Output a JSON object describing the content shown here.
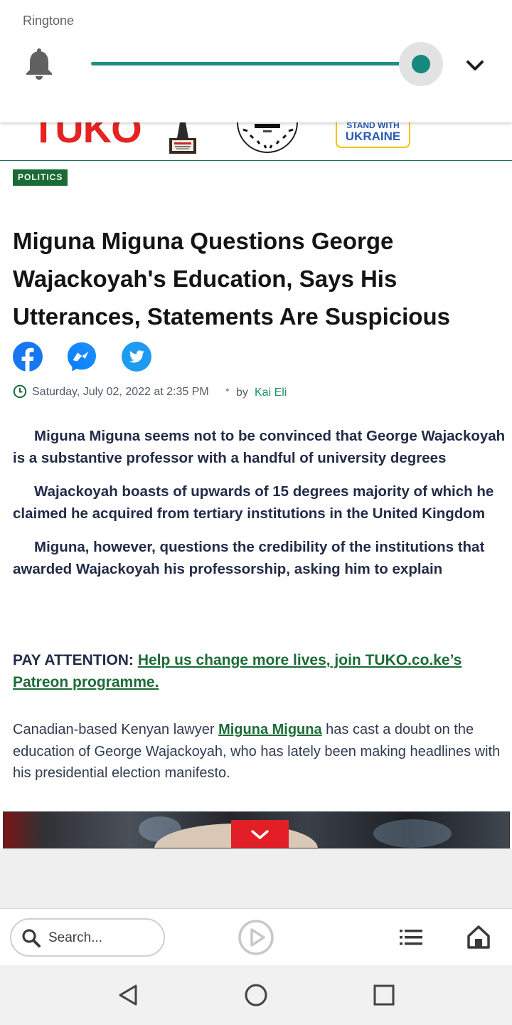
{
  "volume_panel": {
    "label": "Ringtone",
    "level_fraction": 1.0,
    "accent_color": "#15897d"
  },
  "site_header": {
    "logo_text": "TUKO",
    "logo_color": "#e32421",
    "badges": [
      "trophy-award-icon",
      "digital-tech-awards-badge"
    ],
    "ukraine_line1": "STAND WITH",
    "ukraine_line2": "UKRAINE"
  },
  "article": {
    "category": "POLITICS",
    "headline": "Miguna Miguna Questions George Wajackoyah's Education, Says His Utterances, Statements Are Suspicious",
    "share_icons": [
      "facebook-icon",
      "messenger-icon",
      "twitter-icon"
    ],
    "date": "Saturday, July 02, 2022 at 2:35 PM",
    "separator": "•",
    "by_label": "by",
    "author": "Kai Eli",
    "bullets": [
      "Miguna Miguna seems not to be convinced that George Wajackoyah is a substantive professor with a handful of university degrees",
      "Wajackoyah boasts of upwards of 15 degrees majority of which he claimed he acquired from tertiary institutions in the United Kingdom",
      "Miguna, however, questions the credibility of the institutions that awarded Wajackoyah his professorship, asking him to explain"
    ],
    "pay_attention_label": "PAY ATTENTION:",
    "pay_attention_link": "Help us change more lives, join TUKO.co.ke’s Patreon programme.",
    "body_before": "Canadian-based Kenyan lawyer ",
    "body_link": "Miguna Miguna",
    "body_after": " has cast a doubt on the education of George Wajackoyah, who has lately been making headlines with his presidential election manifesto."
  },
  "ad": {
    "close_icon": "chevron-down-icon"
  },
  "bottom_bar": {
    "search_placeholder": "Search...",
    "icons": [
      "search-icon",
      "play-icon",
      "list-icon",
      "home-icon"
    ]
  },
  "system_nav": {
    "icons": [
      "back-icon",
      "home-circle-icon",
      "recents-icon"
    ]
  },
  "colors": {
    "brand_green": "#1b6b36",
    "author_green": "#1b8f6a",
    "text_dark": "#222c48"
  }
}
